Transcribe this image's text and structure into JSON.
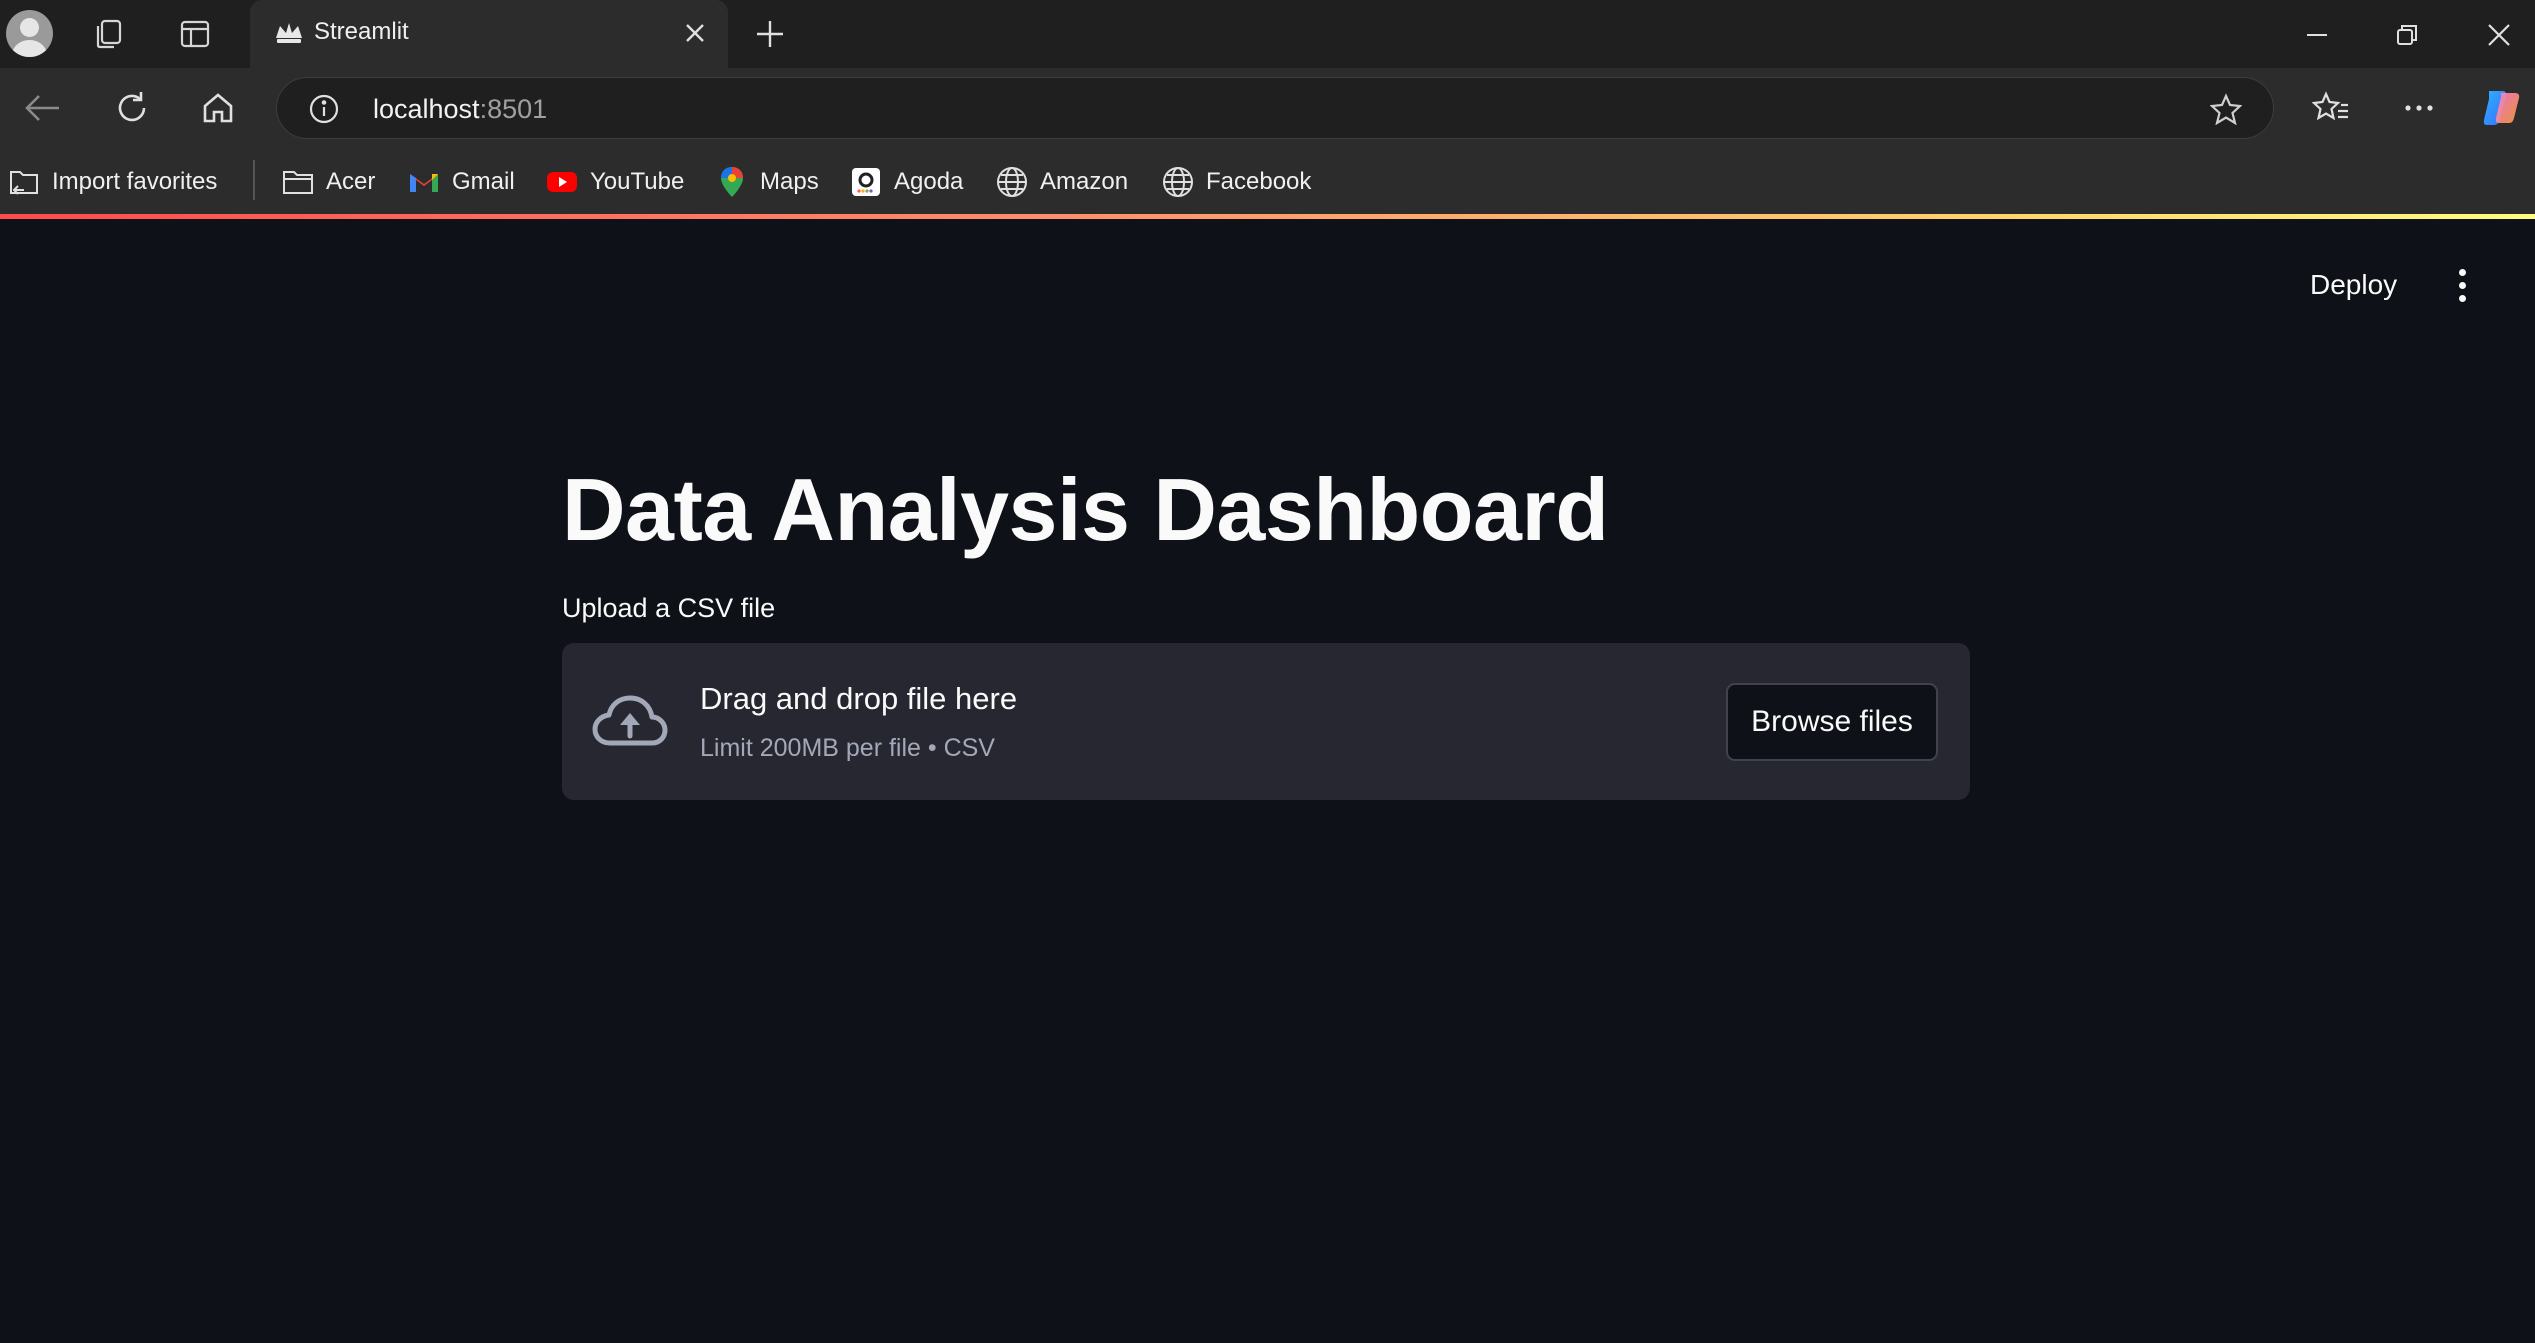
{
  "browser": {
    "tab_title": "Streamlit",
    "url_host": "localhost",
    "url_port": ":8501",
    "bookmarks": [
      {
        "label": "Import favorites",
        "icon": "import-icon"
      },
      {
        "label": "Acer",
        "icon": "folder-icon"
      },
      {
        "label": "Gmail",
        "icon": "gmail-icon"
      },
      {
        "label": "YouTube",
        "icon": "youtube-icon"
      },
      {
        "label": "Maps",
        "icon": "maps-icon"
      },
      {
        "label": "Agoda",
        "icon": "agoda-icon"
      },
      {
        "label": "Amazon",
        "icon": "globe-icon"
      },
      {
        "label": "Facebook",
        "icon": "globe-icon"
      }
    ],
    "colors": {
      "accent_gradient_start": "#ff4b4b",
      "accent_gradient_end": "#fffd80"
    }
  },
  "app": {
    "deploy_label": "Deploy",
    "title": "Data Analysis Dashboard",
    "uploader": {
      "label": "Upload a CSV file",
      "drop_text": "Drag and drop file here",
      "limit_text": "Limit 200MB per file • CSV",
      "button_label": "Browse files"
    },
    "colors": {
      "background": "#0e1117",
      "dropzone": "#262730",
      "text": "#fafafa"
    }
  }
}
